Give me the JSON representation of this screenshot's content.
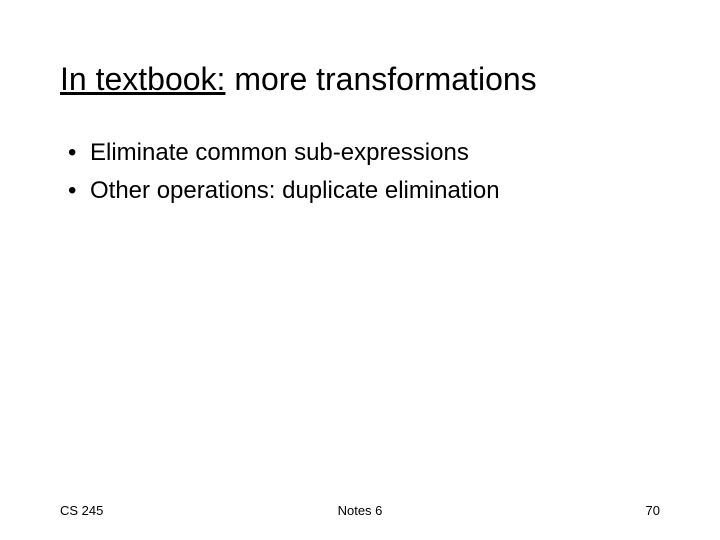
{
  "title": {
    "underlined": "In textbook:",
    "rest": " more transformations"
  },
  "bullets": [
    "Eliminate common sub-expressions",
    "Other operations: duplicate elimination"
  ],
  "footer": {
    "left": "CS 245",
    "center": "Notes 6",
    "right": "70"
  }
}
